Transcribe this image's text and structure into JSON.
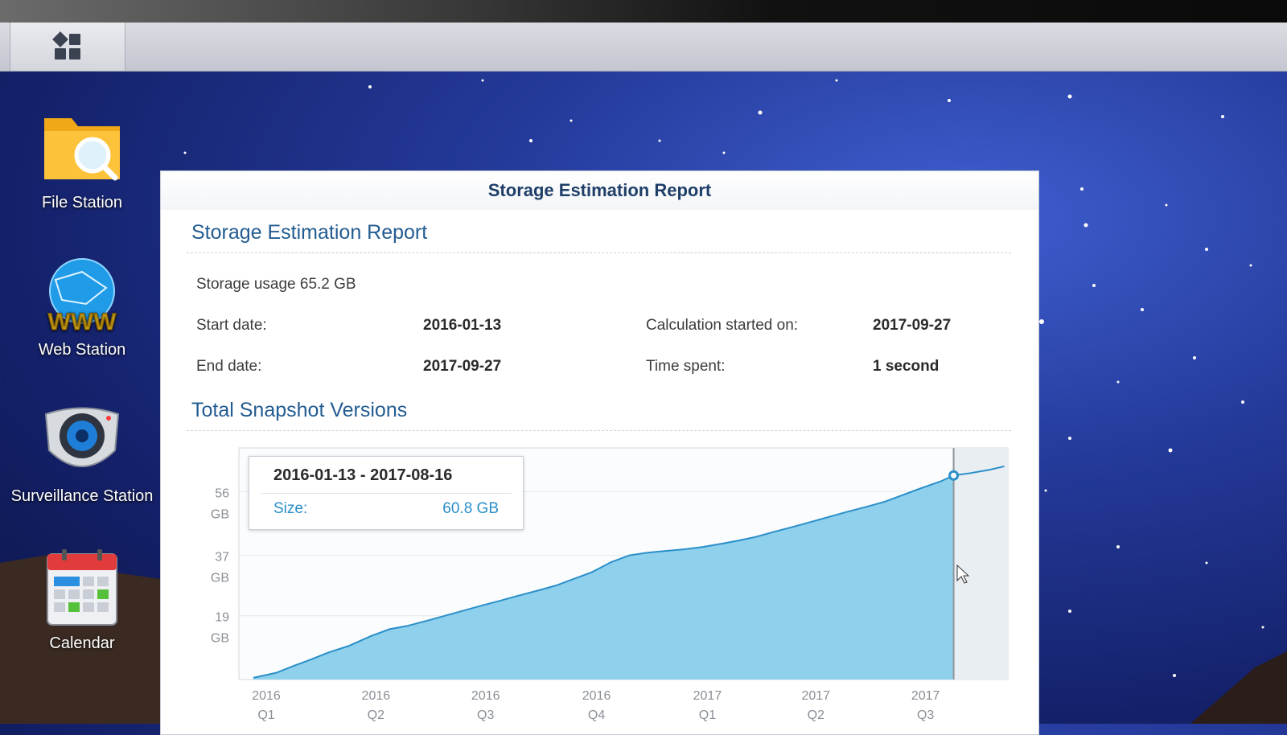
{
  "desktop": {
    "icons": [
      {
        "label": "File Station",
        "icon": "folder-search-icon"
      },
      {
        "label": "Web Station",
        "icon": "globe-www-icon"
      },
      {
        "label": "Surveillance Station",
        "icon": "camera-icon"
      },
      {
        "label": "Calendar",
        "icon": "calendar-icon"
      }
    ]
  },
  "taskbar": {
    "main_menu_icon": "main-menu-grid-icon"
  },
  "window": {
    "title": "Storage Estimation Report",
    "section1_title": "Storage Estimation Report",
    "storage_usage": "Storage usage 65.2 GB",
    "start_date_label": "Start date:",
    "start_date_value": "2016-01-13",
    "end_date_label": "End date:",
    "end_date_value": "2017-09-27",
    "calc_started_label": "Calculation started on:",
    "calc_started_value": "2017-09-27",
    "time_spent_label": "Time spent:",
    "time_spent_value": "1 second",
    "section2_title": "Total Snapshot Versions"
  },
  "tooltip": {
    "range": "2016-01-13 - 2017-08-16",
    "size_label": "Size:",
    "size_value": "60.8 GB"
  },
  "chart_data": {
    "type": "area",
    "title": "",
    "xlabel": "",
    "ylabel": "",
    "xlim": [
      "2016-01-01",
      "2017-09-30"
    ],
    "ylim": [
      0,
      69
    ],
    "y_ticks": [
      {
        "value": 19,
        "line1": "19",
        "line2": "GB"
      },
      {
        "value": 37,
        "line1": "37",
        "line2": "GB"
      },
      {
        "value": 56,
        "line1": "56",
        "line2": "GB"
      }
    ],
    "x_ticks": [
      {
        "value": "2016-01-01",
        "line1": "2016",
        "line2": "Q1"
      },
      {
        "value": "2016-04-01",
        "line1": "2016",
        "line2": "Q2"
      },
      {
        "value": "2016-07-01",
        "line1": "2016",
        "line2": "Q3"
      },
      {
        "value": "2016-10-01",
        "line1": "2016",
        "line2": "Q4"
      },
      {
        "value": "2017-01-01",
        "line1": "2017",
        "line2": "Q1"
      },
      {
        "value": "2017-04-01",
        "line1": "2017",
        "line2": "Q2"
      },
      {
        "value": "2017-07-01",
        "line1": "2017",
        "line2": "Q3"
      }
    ],
    "grid": true,
    "series": [
      {
        "fill_color": "#8fd0ec",
        "line_color": "#2a8fc9",
        "x": [
          "2016-01-13",
          "2016-02-01",
          "2016-02-15",
          "2016-03-01",
          "2016-03-15",
          "2016-04-01",
          "2016-04-20",
          "2016-05-05",
          "2016-05-20",
          "2016-06-05",
          "2016-06-20",
          "2016-07-05",
          "2016-07-20",
          "2016-08-05",
          "2016-08-20",
          "2016-09-05",
          "2016-09-20",
          "2016-10-05",
          "2016-10-20",
          "2016-11-05",
          "2016-11-20",
          "2016-12-05",
          "2016-12-20",
          "2017-01-05",
          "2017-01-20",
          "2017-02-05",
          "2017-02-20",
          "2017-03-05",
          "2017-03-20",
          "2017-04-05",
          "2017-04-20",
          "2017-05-05",
          "2017-05-20",
          "2017-06-05",
          "2017-06-20",
          "2017-07-05",
          "2017-07-20",
          "2017-08-05",
          "2017-08-16",
          "2017-08-30",
          "2017-09-15",
          "2017-09-27"
        ],
        "values": [
          0.5,
          2,
          4,
          6,
          8,
          10,
          13,
          15,
          16,
          17.5,
          19,
          20.5,
          22,
          23.5,
          25,
          26.5,
          28,
          30,
          32,
          35,
          37,
          37.8,
          38.3,
          38.8,
          39.5,
          40.5,
          41.5,
          42.5,
          44,
          45.5,
          47,
          48.5,
          50,
          51.5,
          53,
          55,
          57,
          59,
          60.8,
          61.5,
          62.5,
          63.5
        ]
      }
    ],
    "highlight": {
      "x": "2017-08-16",
      "value": 60.8
    }
  }
}
